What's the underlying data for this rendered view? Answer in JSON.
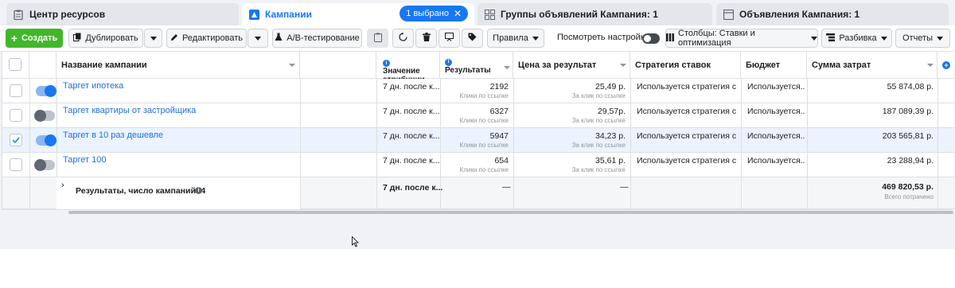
{
  "tabs": [
    {
      "label": "Центр ресурсов",
      "icon": "resource-center-icon"
    },
    {
      "label": "Кампании",
      "icon": "campaigns-icon"
    },
    {
      "label": "Группы объявлений Кампания: 1",
      "icon": "ad-sets-icon"
    },
    {
      "label": "Объявления Кампания: 1",
      "icon": "ads-icon"
    }
  ],
  "selected_badge": "1 выбрано",
  "toolbar": {
    "create": "Создать",
    "duplicate": "Дублировать",
    "edit": "Редактировать",
    "ab_test": "A/B-тестирование",
    "rules": "Правила",
    "view_settings": "Посмотреть настройки",
    "columns": "Столбцы: Ставки и оптимизация",
    "breakdown": "Разбивка",
    "reports": "Отчеты"
  },
  "columns": {
    "name": "Название кампании",
    "attribution": "Значение атрибуции",
    "results": "Результаты",
    "cost_per_result": "Цена за результат",
    "bid_strategy": "Стратегия ставок",
    "budget": "Бюджет",
    "amount_spent": "Сумма затрат"
  },
  "rows": [
    {
      "name": "Таргет ипотека",
      "on": true,
      "selected": false,
      "attribution": "7 дн. после к...",
      "results": "2192",
      "results_sub": "Клики по ссылке",
      "cpr": "25,49 р.",
      "cpr_sub": "За клик по ссылке",
      "strategy": "Используется стратегия с...",
      "budget": "Используется...",
      "spent": "55 874,08 р."
    },
    {
      "name": "Таргет квартиры от застройщика",
      "on": false,
      "selected": false,
      "attribution": "7 дн. после к...",
      "results": "6327",
      "results_sub": "Клики по ссылке",
      "cpr": "29,57р.",
      "cpr_sub": "За клик по ссылке",
      "strategy": "Используется стратегия с...",
      "budget": "Используется...",
      "spent": "187 089,39 р."
    },
    {
      "name": "Таргет в 10 раз дешевле",
      "on": true,
      "selected": true,
      "attribution": "7 дн. после к...",
      "results": "5947",
      "results_sub": "Клики по ссылке",
      "cpr": "34,23 р.",
      "cpr_sub": "За клик по ссылке",
      "strategy": "Используется стратегия с...",
      "budget": "Используется...",
      "spent": "203 565,81 р."
    },
    {
      "name": "Таргет 100",
      "on": false,
      "selected": false,
      "attribution": "7 дн. после к...",
      "results": "654",
      "results_sub": "Клики по ссылке",
      "cpr": "35,61 р.",
      "cpr_sub": "За клик по ссылке",
      "strategy": "Используется стратегия с...",
      "budget": "Используется...",
      "spent": "23 288,94 р."
    }
  ],
  "summary": {
    "label": "Результаты, число кампаний: 4",
    "attribution": "7 дн. после к...",
    "results": "—",
    "cpr": "—",
    "spent": "469 820,53 р.",
    "spent_sub": "Всего потрачено"
  },
  "colors": {
    "accent": "#1877f2",
    "create": "#42b72a",
    "link": "#216fdb"
  }
}
